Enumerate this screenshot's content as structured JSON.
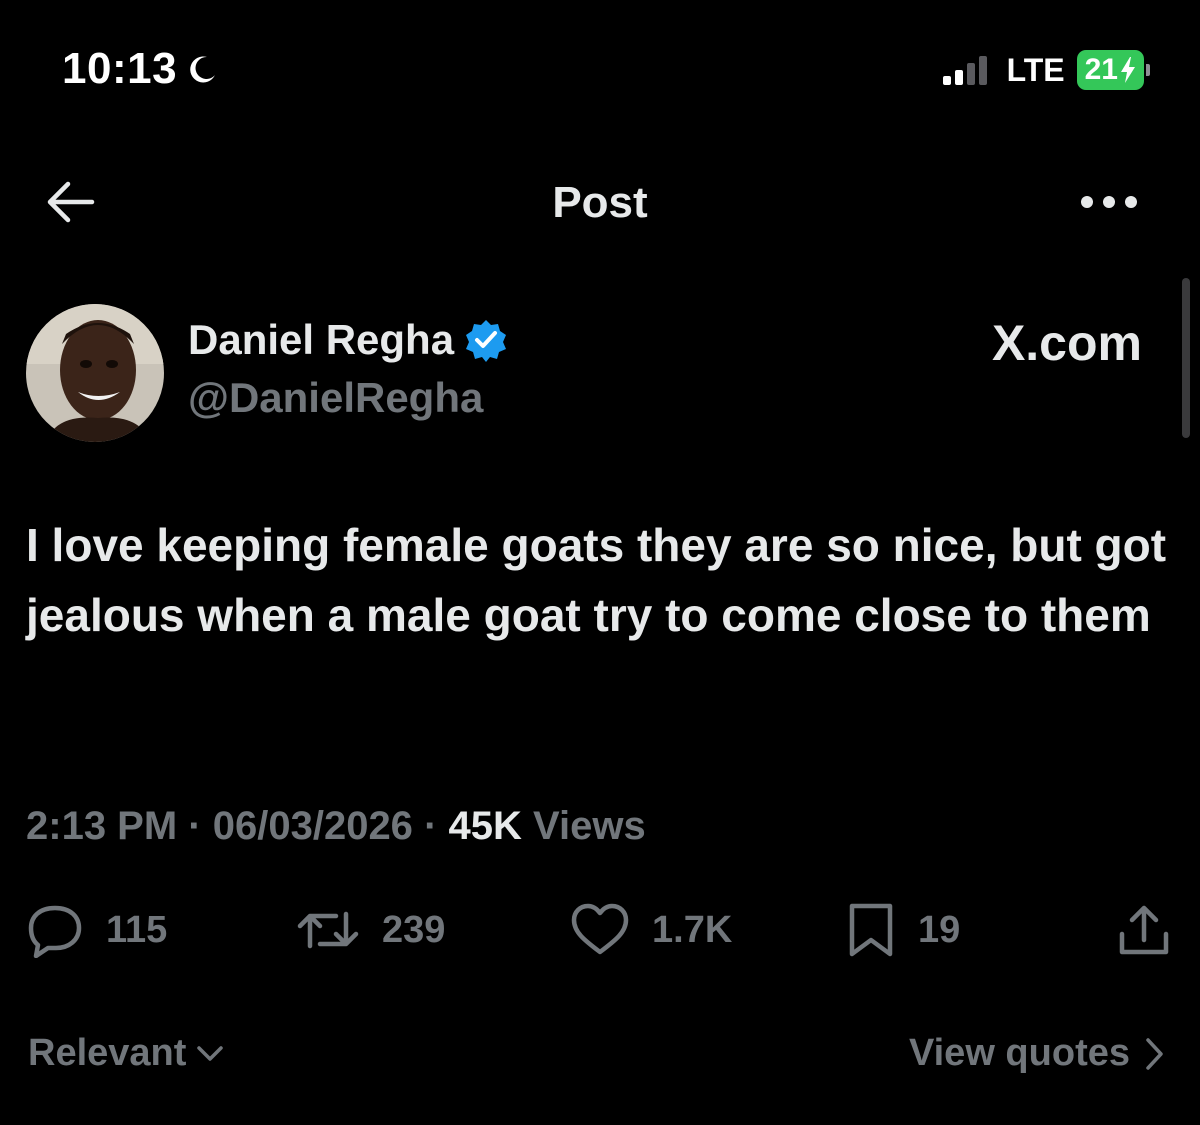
{
  "status_bar": {
    "time": "10:13",
    "network": "LTE",
    "battery": "21"
  },
  "header": {
    "title": "Post"
  },
  "author": {
    "name": "Daniel Regha",
    "handle": "@DanielRegha"
  },
  "watermark": "X.com",
  "tweet": {
    "text": "I love keeping female goats they are so nice, but got jealous when a male goat try to come close to them",
    "time": "2:13 PM",
    "date": "06/03/2026",
    "views_count": "45K",
    "views_label": "Views"
  },
  "actions": {
    "replies": "115",
    "retweets": "239",
    "likes": "1.7K",
    "bookmarks": "19"
  },
  "footer": {
    "sort_label": "Relevant",
    "quotes_label": "View quotes"
  },
  "colors": {
    "background": "#000000",
    "text_primary": "#e7e9ea",
    "text_secondary": "#71767b",
    "verified": "#1d9bf0",
    "battery": "#34c759"
  },
  "icons": {
    "back": "arrow-left-icon",
    "more": "ellipsis-icon",
    "verified": "verified-badge-icon",
    "reply": "reply-icon",
    "retweet": "retweet-icon",
    "like": "heart-icon",
    "bookmark": "bookmark-icon",
    "share": "share-icon"
  }
}
